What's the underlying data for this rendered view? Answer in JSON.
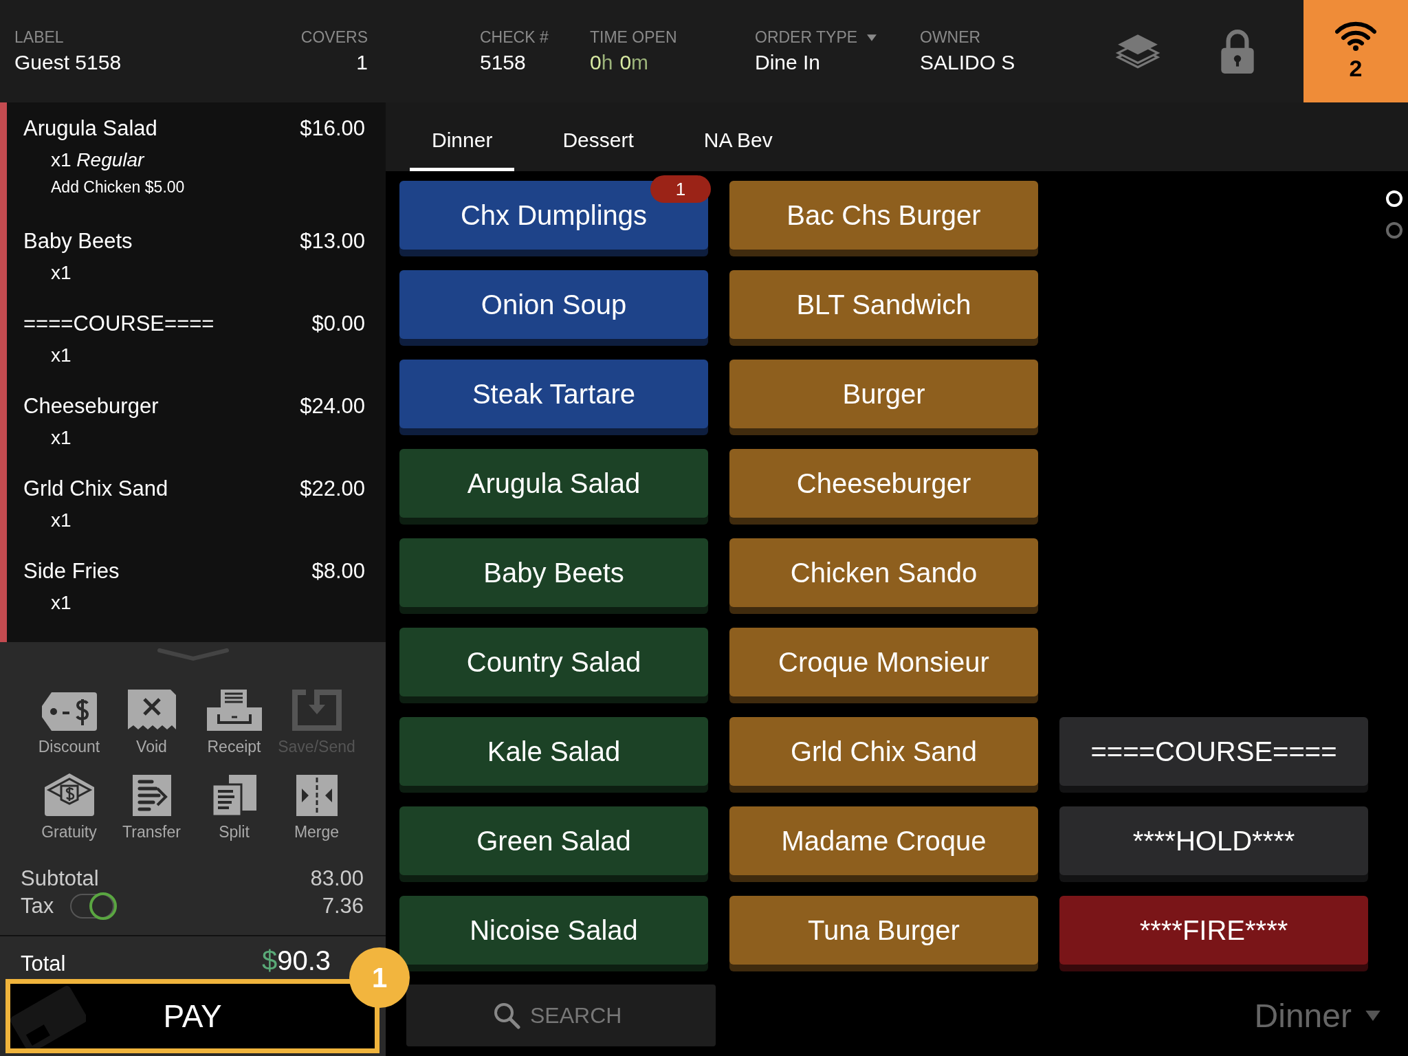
{
  "header": {
    "fields": [
      {
        "kind": "text",
        "label": "LABEL",
        "value": "Guest 5158"
      },
      {
        "kind": "number",
        "label": "COVERS",
        "value": "1"
      },
      {
        "kind": "text",
        "label": "CHECK #",
        "value": "5158"
      },
      {
        "kind": "time",
        "label": "TIME OPEN",
        "parts": [
          {
            "text": "0",
            "kind": "number"
          },
          {
            "text": "h",
            "kind": "unit"
          },
          {
            "text": "0",
            "kind": "number"
          },
          {
            "text": "m",
            "kind": "unit"
          }
        ]
      },
      {
        "kind": "dropdown",
        "label": "ORDER TYPE",
        "value": "Dine In"
      },
      {
        "kind": "text",
        "label": "OWNER",
        "value": "SALIDO S"
      }
    ],
    "network_count": "2"
  },
  "order": {
    "items": [
      {
        "name": "Arugula Salad",
        "price": "$16.00",
        "quantity": "x1 *Regular*",
        "note": "Add Chicken $5.00"
      },
      {
        "name": "Baby Beets",
        "price": "$13.00",
        "quantity": "x1"
      },
      {
        "name": "====COURSE====",
        "price": "$0.00",
        "quantity": "x1"
      },
      {
        "name": "Cheeseburger",
        "price": "$24.00",
        "quantity": "x1"
      },
      {
        "name": "Grld Chix Sand",
        "price": "$22.00",
        "quantity": "x1"
      },
      {
        "name": "Side Fries",
        "price": "$8.00",
        "quantity": "x1"
      }
    ]
  },
  "actions": [
    {
      "kind": "discount",
      "label": "Discount",
      "disabled": false
    },
    {
      "kind": "void",
      "label": "Void",
      "disabled": false
    },
    {
      "kind": "receipt",
      "label": "Receipt",
      "disabled": false
    },
    {
      "kind": "save",
      "label": "Save/Send",
      "disabled": true
    },
    {
      "kind": "gratuity",
      "label": "Gratuity",
      "disabled": false
    },
    {
      "kind": "transfer",
      "label": "Transfer",
      "disabled": false
    },
    {
      "kind": "split",
      "label": "Split",
      "disabled": false
    },
    {
      "kind": "merge",
      "label": "Merge",
      "disabled": false
    }
  ],
  "totals": {
    "subtotal_label": "Subtotal",
    "subtotal": "83.00",
    "tax_label": "Tax",
    "tax_on": true,
    "tax": "7.36",
    "total_label": "Total",
    "total_currency": "$",
    "total_amount": "90.3"
  },
  "pay": {
    "label": "PAY",
    "step_badge": "1"
  },
  "tabs": [
    {
      "label": "Dinner",
      "selected": true
    },
    {
      "label": "Dessert",
      "selected": false
    },
    {
      "label": "NA Bev",
      "selected": false
    }
  ],
  "menu_rows": [
    [
      {
        "label": "Chx Dumplings",
        "color": "#1e4389",
        "badge": "1"
      },
      {
        "label": "Bac Chs Burger",
        "color": "#8e5f1e"
      }
    ],
    [
      {
        "label": "Onion Soup",
        "color": "#1e4389"
      },
      {
        "label": "BLT Sandwich",
        "color": "#8e5f1e"
      }
    ],
    [
      {
        "label": "Steak Tartare",
        "color": "#1e4389"
      },
      {
        "label": "Burger",
        "color": "#8e5f1e"
      }
    ],
    [
      {
        "label": "Arugula Salad",
        "color": "#1c4226"
      },
      {
        "label": "Cheeseburger",
        "color": "#8e5f1e"
      }
    ],
    [
      {
        "label": "Baby Beets",
        "color": "#1c4226"
      },
      {
        "label": "Chicken Sando",
        "color": "#8e5f1e"
      }
    ],
    [
      {
        "label": "Country Salad",
        "color": "#1c4226"
      },
      {
        "label": "Croque Monsieur",
        "color": "#8e5f1e"
      }
    ],
    [
      {
        "label": "Kale Salad",
        "color": "#1c4226"
      },
      {
        "label": "Grld Chix Sand",
        "color": "#8e5f1e"
      },
      {
        "label": "====COURSE====",
        "color": "#2a2a2c"
      }
    ],
    [
      {
        "label": "Green Salad",
        "color": "#1c4226"
      },
      {
        "label": "Madame Croque",
        "color": "#8e5f1e"
      },
      {
        "label": "****HOLD****",
        "color": "#2a2a2c"
      }
    ],
    [
      {
        "label": "Nicoise Salad",
        "color": "#1c4226"
      },
      {
        "label": "Tuna Burger",
        "color": "#8e5f1e"
      },
      {
        "label": "****FIRE****",
        "color": "#7a1518"
      }
    ]
  ],
  "pages": [
    {
      "selected": true
    },
    {
      "selected": false
    }
  ],
  "search": {
    "placeholder": "SEARCH"
  },
  "menu_selector": {
    "value": "Dinner"
  }
}
